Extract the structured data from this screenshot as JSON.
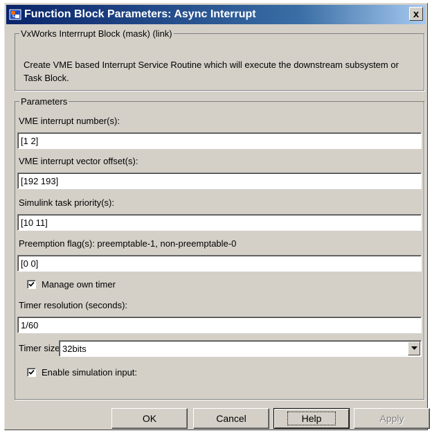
{
  "window": {
    "title": "Function Block Parameters: Async Interrupt",
    "close_label": "x"
  },
  "mask": {
    "legend": "VxWorks Interrrupt Block (mask) (link)",
    "description": "Create VME based Interrupt Service Routine which will execute the downstream subsystem or Task Block."
  },
  "parameters": {
    "legend": "Parameters",
    "fields": [
      {
        "label": "VME interrupt number(s):",
        "value": "[1 2]"
      },
      {
        "label": "VME interrupt vector offset(s):",
        "value": "[192 193]"
      },
      {
        "label": "Simulink task priority(s):",
        "value": "[10 11]"
      },
      {
        "label": "Preemption flag(s): preemptable-1, non-preemptable-0",
        "value": "[0 0]"
      }
    ],
    "manage_timer": {
      "label": "Manage own timer",
      "checked": true
    },
    "timer_resolution": {
      "label": "Timer resolution (seconds):",
      "value": "1/60"
    },
    "timer_size": {
      "label": "Timer size",
      "selected": "32bits"
    },
    "enable_sim": {
      "label": "Enable simulation input:",
      "checked": true
    }
  },
  "buttons": {
    "ok": "OK",
    "cancel": "Cancel",
    "help": "Help",
    "apply": "Apply"
  },
  "icons": {
    "app": "simulink-block-icon",
    "close": "close-icon",
    "check": "check-icon",
    "dropdown": "chevron-down-icon"
  }
}
